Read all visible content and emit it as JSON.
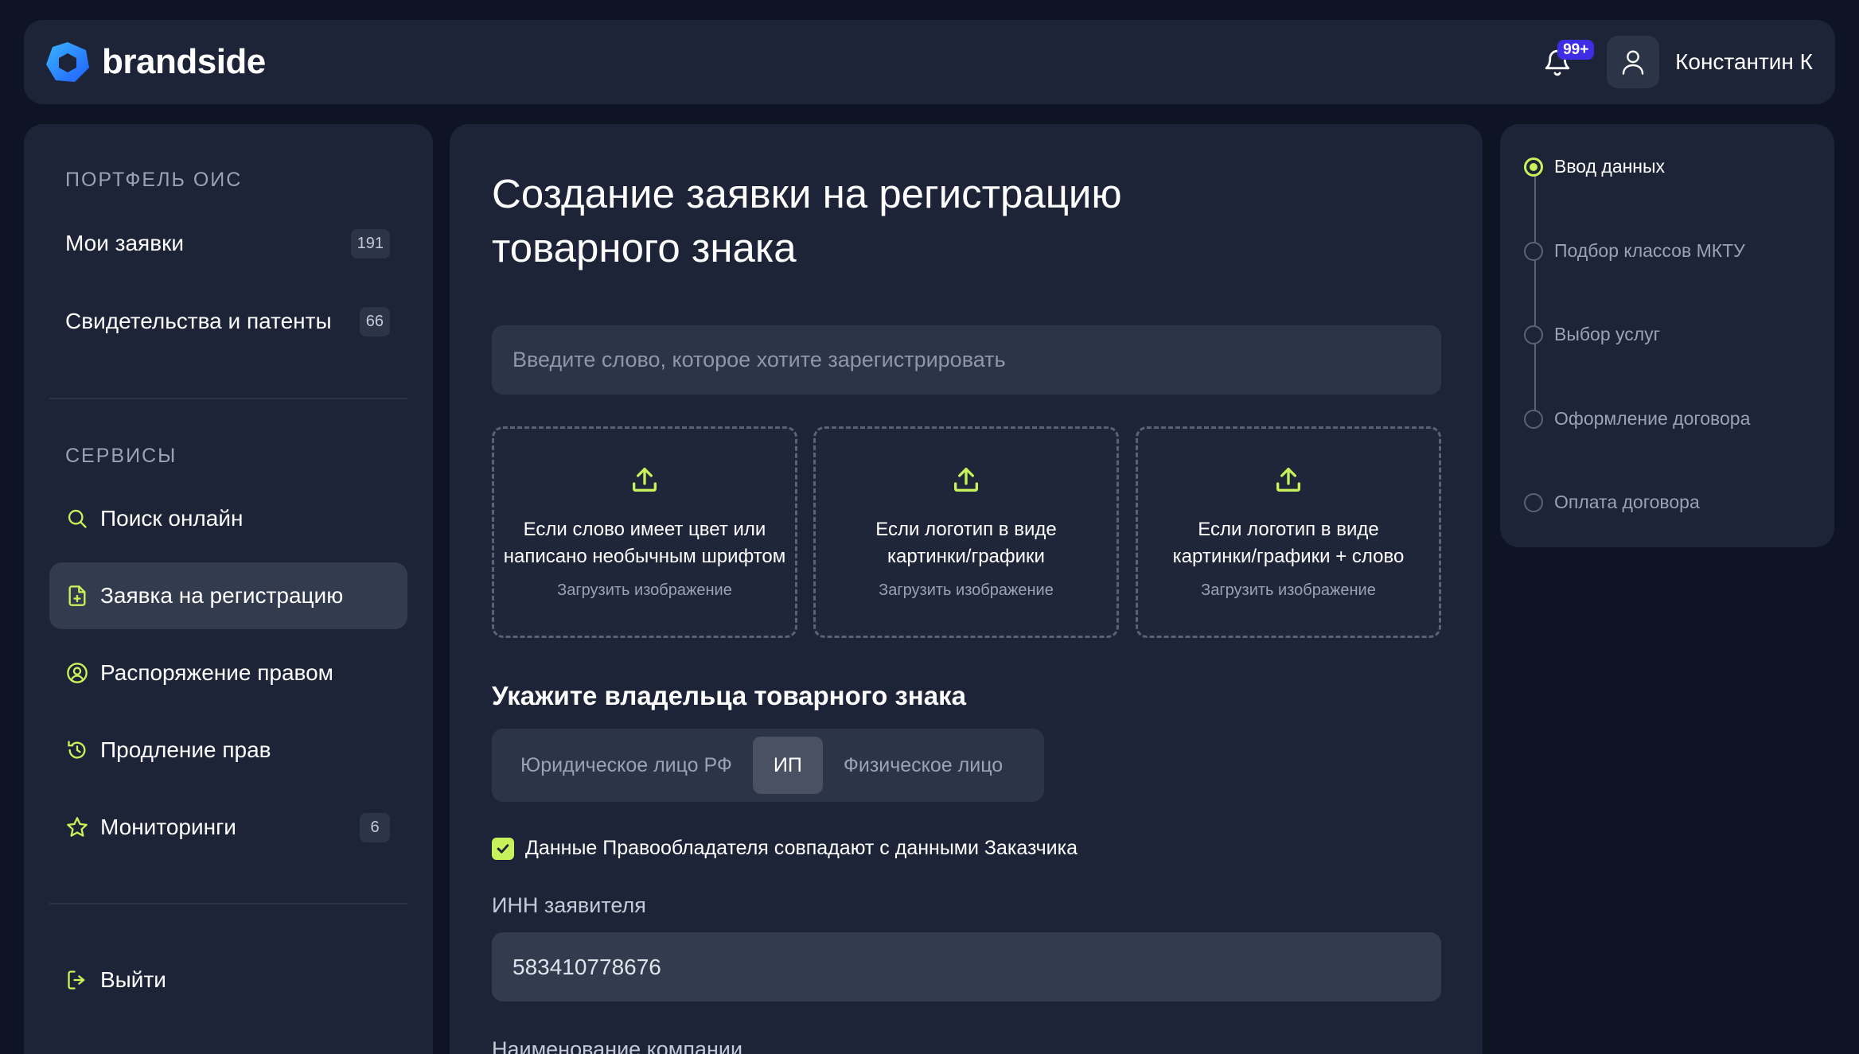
{
  "colors": {
    "background": "#0f1424",
    "panel": "#1d2437",
    "accent": "#c7f25c",
    "badge": "#3d2ee6"
  },
  "header": {
    "logo_text": "brandside",
    "notifications_badge": "99+",
    "user_name": "Константин К"
  },
  "sidebar": {
    "portfolio_title": "ПОРТФЕЛЬ ОИС",
    "portfolio_items": [
      {
        "label": "Мои заявки",
        "count": "191"
      },
      {
        "label": "Свидетельства и патенты",
        "count": "66"
      }
    ],
    "services_title": "СЕРВИСЫ",
    "services_items": [
      {
        "label": "Поиск онлайн",
        "icon": "search-icon"
      },
      {
        "label": "Заявка на регистрацию",
        "icon": "file-plus-icon"
      },
      {
        "label": "Распоряжение правом",
        "icon": "user-circle-icon"
      },
      {
        "label": "Продление прав",
        "icon": "timer-icon"
      },
      {
        "label": "Мониторинги",
        "icon": "star-icon",
        "count": "6"
      }
    ],
    "logout_label": "Выйти"
  },
  "main": {
    "title_line1": "Создание заявки на регистрацию",
    "title_line2": "товарного знака",
    "word_placeholder": "Введите слово, которое хотите зарегистрировать",
    "upload_cards": [
      {
        "line1": "Если слово имеет цвет или",
        "line2": "написано необычным шрифтом",
        "hint": "Загрузить изображение"
      },
      {
        "line1": "Если логотип в виде",
        "line2": "картинки/графики",
        "hint": "Загрузить изображение"
      },
      {
        "line1": "Если логотип в виде",
        "line2": "картинки/графики + слово",
        "hint": "Загрузить изображение"
      }
    ],
    "owner_title": "Укажите владельца товарного знака",
    "owner_options": [
      "Юридическое лицо РФ",
      "ИП",
      "Физическое лицо"
    ],
    "owner_selected": "ИП",
    "same_data_label": "Данные Правообладателя совпадают с данными Заказчика",
    "same_data_checked": true,
    "inn_label": "ИНН заявителя",
    "inn_value": "583410778676",
    "company_label": "Наименование компании"
  },
  "steps": [
    {
      "label": "Ввод данных",
      "current": true
    },
    {
      "label": "Подбор классов МКТУ",
      "current": false
    },
    {
      "label": "Выбор услуг",
      "current": false
    },
    {
      "label": "Оформление договора",
      "current": false
    },
    {
      "label": "Оплата договора",
      "current": false
    }
  ]
}
